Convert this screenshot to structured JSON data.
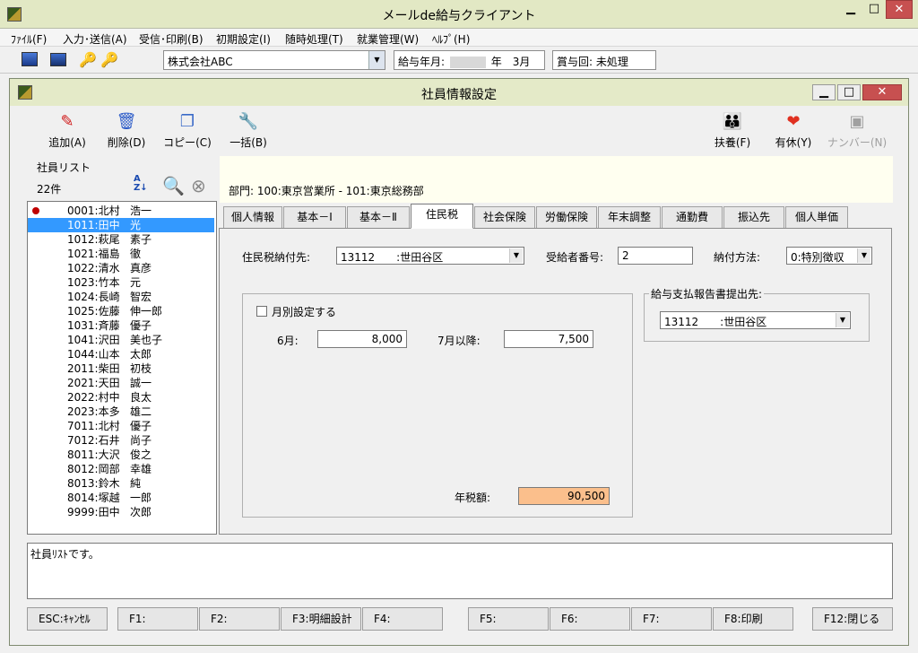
{
  "window": {
    "title": "メールde給与クライアント"
  },
  "menu": [
    "ﾌｧｲﾙ(F)",
    "入力･送信(A)",
    "受信･印刷(B)",
    "初期設定(I)",
    "随時処理(T)",
    "就業管理(W)",
    "ﾍﾙﾌﾟ(H)"
  ],
  "toolbar": {
    "company": "株式会社ABC",
    "pay_month_label": "給与年月:",
    "pay_month_suffix": "年　3月",
    "bonus": "賞与回: 未処理"
  },
  "dialog": {
    "title": "社員情報設定",
    "buttons": {
      "add": "追加(A)",
      "delete": "削除(D)",
      "copy": "コピー(C)",
      "bulk": "一括(B)",
      "dependents": "扶養(F)",
      "paid_leave": "有休(Y)",
      "number": "ナンバー(N)"
    }
  },
  "list": {
    "header": "社員リスト",
    "count": "22件",
    "employees": [
      {
        "code": "0001:北村",
        "name": "浩一"
      },
      {
        "code": "1011:田中",
        "name": "光"
      },
      {
        "code": "1012:萩尾",
        "name": "素子"
      },
      {
        "code": "1021:福島",
        "name": "徹"
      },
      {
        "code": "1022:清水",
        "name": "真彦"
      },
      {
        "code": "1023:竹本",
        "name": "元"
      },
      {
        "code": "1024:長崎",
        "name": "智宏"
      },
      {
        "code": "1025:佐藤",
        "name": "伸一郎"
      },
      {
        "code": "1031:斉藤",
        "name": "優子"
      },
      {
        "code": "1041:沢田",
        "name": "美也子"
      },
      {
        "code": "1044:山本",
        "name": "太郎"
      },
      {
        "code": "2011:柴田",
        "name": "初枝"
      },
      {
        "code": "2021:天田",
        "name": "誠一"
      },
      {
        "code": "2022:村中",
        "name": "良太"
      },
      {
        "code": "2023:本多",
        "name": "雄二"
      },
      {
        "code": "7011:北村",
        "name": "優子"
      },
      {
        "code": "7012:石井",
        "name": "尚子"
      },
      {
        "code": "8011:大沢",
        "name": "俊之"
      },
      {
        "code": "8012:岡部",
        "name": "幸雄"
      },
      {
        "code": "8013:鈴木",
        "name": "純"
      },
      {
        "code": "8014:塚越",
        "name": "一郎"
      },
      {
        "code": "9999:田中",
        "name": "次郎"
      }
    ]
  },
  "department": "部門:  100:東京営業所 - 101:東京総務部",
  "tabs": [
    "個人情報",
    "基本－Ⅰ",
    "基本－Ⅱ",
    "住民税",
    "社会保険",
    "労働保険",
    "年末調整",
    "通勤費",
    "振込先",
    "個人単価"
  ],
  "active_tab": "住民税",
  "resident_tax": {
    "pay_to_label": "住民税納付先:",
    "pay_to_value": "13112　　:世田谷区",
    "recipient_no_label": "受給者番号:",
    "recipient_no_value": "2",
    "payment_method_label": "納付方法:",
    "payment_method_value": "0:特別徴収",
    "monthly_label": "月別設定する",
    "june_label": "6月:",
    "june_value": "8,000",
    "july_label": "7月以降:",
    "july_value": "7,500",
    "annual_label": "年税額:",
    "annual_value": "90,500",
    "report_group_label": "給与支払報告書提出先:",
    "report_value": "13112　　:世田谷区"
  },
  "status": "社員ﾘｽﾄです。",
  "fkeys": [
    "ESC:ｷｬﾝｾﾙ",
    "F1:",
    "F2:",
    "F3:明細設計",
    "F4:",
    "F5:",
    "F6:",
    "F7:",
    "F8:印刷",
    "F12:閉じる"
  ],
  "colors": {
    "selection": "#3399ff",
    "annual_tax_bg": "#fbbf8c",
    "dept_bg": "#fffff0"
  }
}
